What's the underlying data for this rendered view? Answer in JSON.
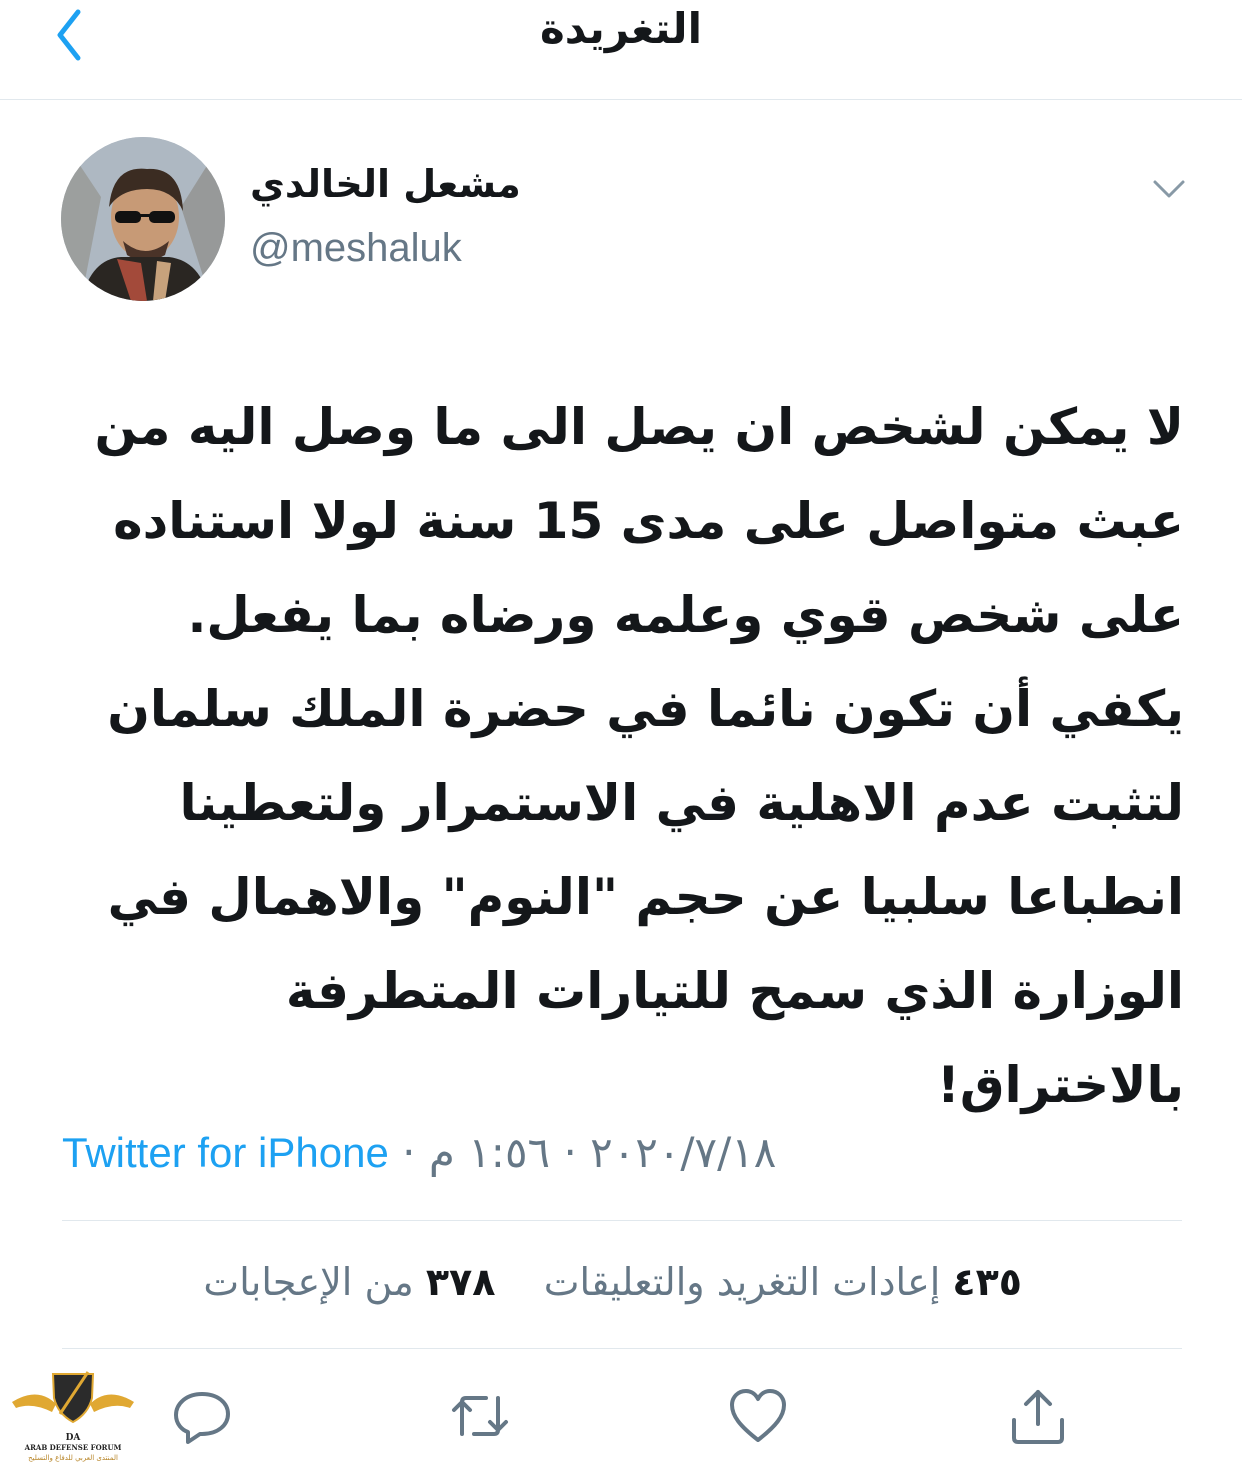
{
  "header": {
    "title": "التغريدة"
  },
  "author": {
    "display_name": "مشعل الخالدي",
    "handle": "@meshaluk"
  },
  "tweet": {
    "text": "لا يمكن لشخص ان يصل الى ما وصل اليه من عبث متواصل على مدى 15 سنة لولا استناده على شخص قوي وعلمه ورضاه بما يفعل. يكفي أن تكون نائما في حضرة الملك سلمان لتثبت عدم الاهلية في الاستمرار ولتعطينا انطباعا سلبيا عن حجم \"النوم\" والاهمال في الوزارة الذي سمح للتيارات المتطرفة بالاختراق!",
    "time": "١:٥٦ م",
    "date": "٢٠٢٠/٧/١٨",
    "separator": "·",
    "source": "Twitter for iPhone"
  },
  "stats": {
    "retweets_count": "٤٣٥",
    "retweets_label": "إعادات التغريد والتعليقات",
    "likes_count": "٣٧٨",
    "likes_label": "من الإعجابات"
  },
  "watermark": {
    "logo_letters": "DA",
    "name_en": "ARAB DEFENSE FORUM",
    "name_ar": "المنتدى العربي للدفاع والتسليح"
  },
  "colors": {
    "accent": "#1da1f2",
    "secondary_text": "#657786",
    "divider": "#e1e8ed",
    "primary_text": "#14171a"
  }
}
